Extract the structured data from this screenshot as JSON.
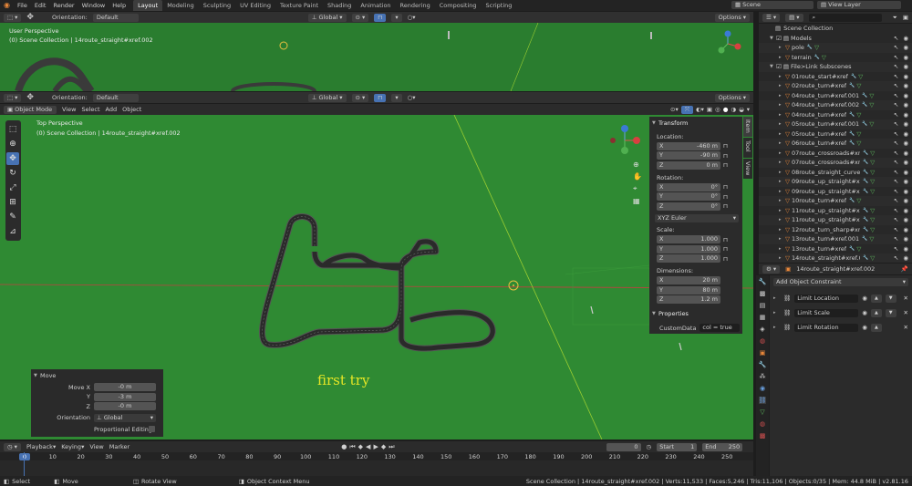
{
  "topbar": {
    "menus": [
      "File",
      "Edit",
      "Render",
      "Window",
      "Help"
    ],
    "workspaces": [
      "Layout",
      "Modeling",
      "Sculpting",
      "UV Editing",
      "Texture Paint",
      "Shading",
      "Animation",
      "Rendering",
      "Compositing",
      "Scripting"
    ],
    "active_workspace": "Layout",
    "scene": "Scene",
    "view_layer": "View Layer"
  },
  "vp_top": {
    "orientation_label": "Orientation:",
    "orientation_value": "Default",
    "transform_space": "Global",
    "options": "Options",
    "perspective": "User Perspective",
    "collection_info": "(0) Scene Collection | 14route_straight#xref.002"
  },
  "vp_main": {
    "mode": "Object Mode",
    "menus": [
      "View",
      "Select",
      "Add",
      "Object"
    ],
    "orientation_label": "Orientation:",
    "orientation_value": "Default",
    "transform_space": "Global",
    "options": "Options",
    "perspective": "Top Perspective",
    "collection_info": "(0) Scene Collection | 14route_straight#xref.002",
    "annotation": "first try",
    "tabs": [
      "Item",
      "Tool",
      "View"
    ]
  },
  "sidebar": {
    "transform_title": "Transform",
    "location_label": "Location:",
    "location": [
      {
        "axis": "X",
        "value": "-460 m"
      },
      {
        "axis": "Y",
        "value": "-90 m"
      },
      {
        "axis": "Z",
        "value": "0 m"
      }
    ],
    "rotation_label": "Rotation:",
    "rotation": [
      {
        "axis": "X",
        "value": "0°"
      },
      {
        "axis": "Y",
        "value": "0°"
      },
      {
        "axis": "Z",
        "value": "0°"
      }
    ],
    "rotation_mode": "XYZ Euler",
    "scale_label": "Scale:",
    "scale": [
      {
        "axis": "X",
        "value": "1.000"
      },
      {
        "axis": "Y",
        "value": "1.000"
      },
      {
        "axis": "Z",
        "value": "1.000"
      }
    ],
    "dimensions_label": "Dimensions:",
    "dimensions": [
      {
        "axis": "X",
        "value": "20 m"
      },
      {
        "axis": "Y",
        "value": "80 m"
      },
      {
        "axis": "Z",
        "value": "1.2 m"
      }
    ],
    "properties_title": "Properties",
    "custom_key": "CustomData",
    "custom_value": "col = true"
  },
  "operator": {
    "title": "Move",
    "fields": [
      {
        "label": "Move X",
        "value": "-0 m"
      },
      {
        "label": "Y",
        "value": "-3 m"
      },
      {
        "label": "Z",
        "value": "-0 m"
      }
    ],
    "orientation_label": "Orientation",
    "orientation_value": "Global",
    "proportional_label": "Proportional Editing"
  },
  "outliner": {
    "root": "Scene Collection",
    "items": [
      {
        "name": "Models",
        "level": 1,
        "type": "collection"
      },
      {
        "name": "pole",
        "level": 2,
        "type": "object"
      },
      {
        "name": "terrain",
        "level": 2,
        "type": "object"
      },
      {
        "name": "File>Link Subscenes",
        "level": 1,
        "type": "collection"
      },
      {
        "name": "01route_start#xref",
        "level": 2,
        "type": "object"
      },
      {
        "name": "02route_turn#xref",
        "level": 2,
        "type": "object"
      },
      {
        "name": "04route_turn#xref.001",
        "level": 2,
        "type": "object"
      },
      {
        "name": "04route_turn#xref.002",
        "level": 2,
        "type": "object"
      },
      {
        "name": "04route_turn#xref",
        "level": 2,
        "type": "object"
      },
      {
        "name": "05route_turn#xref.001",
        "level": 2,
        "type": "object"
      },
      {
        "name": "05route_turn#xref",
        "level": 2,
        "type": "object"
      },
      {
        "name": "06route_turn#xref",
        "level": 2,
        "type": "object"
      },
      {
        "name": "07route_crossroads#xref.001",
        "level": 2,
        "type": "object"
      },
      {
        "name": "07route_crossroads#xref",
        "level": 2,
        "type": "object"
      },
      {
        "name": "08route_straight_curved#xref",
        "level": 2,
        "type": "object"
      },
      {
        "name": "09route_up_straight#xref.001",
        "level": 2,
        "type": "object"
      },
      {
        "name": "09route_up_straight#xref",
        "level": 2,
        "type": "object"
      },
      {
        "name": "10route_turn#xref",
        "level": 2,
        "type": "object"
      },
      {
        "name": "11route_up_straight#xref.001",
        "level": 2,
        "type": "object"
      },
      {
        "name": "11route_up_straight#xref",
        "level": 2,
        "type": "object"
      },
      {
        "name": "12route_turn_sharp#xref",
        "level": 2,
        "type": "object"
      },
      {
        "name": "13route_turn#xref.001",
        "level": 2,
        "type": "object"
      },
      {
        "name": "13route_turn#xref",
        "level": 2,
        "type": "object"
      },
      {
        "name": "14route_straight#xref.001",
        "level": 2,
        "type": "object"
      }
    ]
  },
  "properties": {
    "object_name": "14route_straight#xref.002",
    "add_constraint": "Add Object Constraint",
    "constraints": [
      "Limit Location",
      "Limit Scale",
      "Limit Rotation"
    ]
  },
  "timeline": {
    "menus": [
      "Playback",
      "Keying",
      "View",
      "Marker"
    ],
    "current_frame": "0",
    "start_label": "Start",
    "start": "1",
    "end_label": "End",
    "end": "250",
    "ticks": [
      "0",
      "10",
      "20",
      "30",
      "40",
      "50",
      "60",
      "70",
      "80",
      "90",
      "100",
      "110",
      "120",
      "130",
      "140",
      "150",
      "160",
      "170",
      "180",
      "190",
      "200",
      "210",
      "220",
      "230",
      "240",
      "250"
    ]
  },
  "status": {
    "select": "Select",
    "move": "Move",
    "rotate": "Rotate View",
    "context": "Object Context Menu",
    "info": "Scene Collection | 14route_straight#xref.002 | Verts:11,533 | Faces:5,246 | Tris:11,106 | Objects:0/35 | Mem: 44.8 MiB | v2.81.16"
  }
}
